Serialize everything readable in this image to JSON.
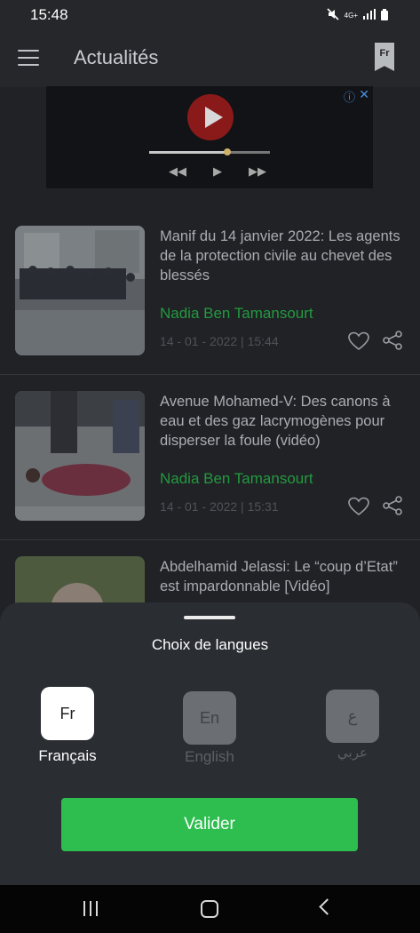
{
  "status_bar": {
    "time": "15:48",
    "network": "4G+"
  },
  "app_bar": {
    "title": "Actualités",
    "lang_badge": "Fr"
  },
  "articles": [
    {
      "title": "Manif du 14 janvier 2022: Les agents de la protection civile au chevet des blessés",
      "author": "Nadia Ben Tamansourt",
      "date": "14 - 01 - 2022 | 15:44"
    },
    {
      "title": "Avenue Mohamed-V: Des canons à eau et des gaz lacrymogènes  pour disperser la foule (vidéo)",
      "author": "Nadia Ben Tamansourt",
      "date": "14 - 01 - 2022 | 15:31"
    },
    {
      "title": "Abdelhamid Jelassi: Le “coup d’Etat” est impardonnable [Vidéo]",
      "author": "",
      "date": ""
    }
  ],
  "sheet": {
    "title": "Choix de langues",
    "options": [
      {
        "code": "Fr",
        "label": "Français",
        "selected": true
      },
      {
        "code": "En",
        "label": "English",
        "selected": false
      },
      {
        "code": "ع",
        "label": "عربي",
        "selected": false
      }
    ],
    "validate_label": "Valider"
  },
  "colors": {
    "accent_green": "#2ebd4f",
    "author_green": "#239a3f",
    "background": "#202226",
    "sheet_background": "#2a2d32"
  }
}
